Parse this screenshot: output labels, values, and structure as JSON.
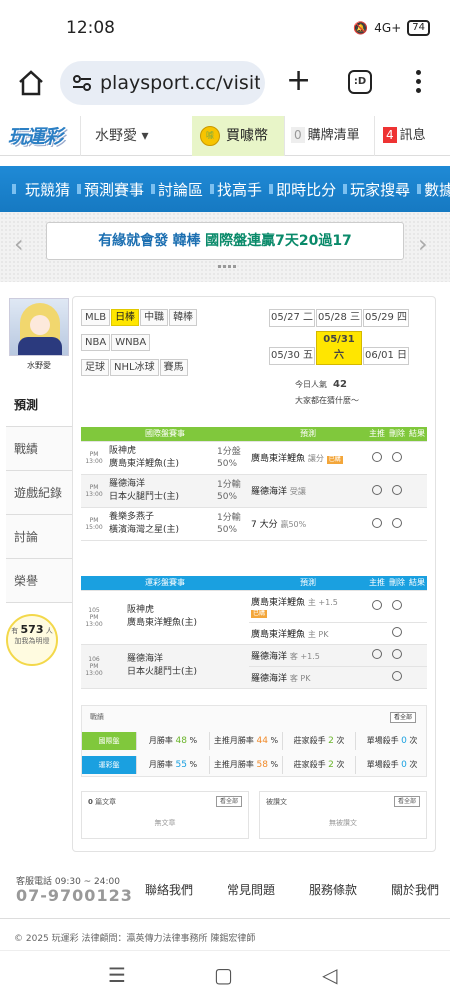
{
  "status": {
    "time": "12:08",
    "battery": "74",
    "signal": "4G+"
  },
  "browser": {
    "url": "playsport.cc/visit",
    "tab_count": ":D"
  },
  "topnav": {
    "logo": "玩運彩",
    "user": "水野愛 ▾",
    "buy": "買噱幣",
    "coin": "噱",
    "cart_count": "0",
    "cart": "購牌清單",
    "msg_count": "4",
    "msg": "訊息"
  },
  "mainnav": [
    "玩競猜",
    "預測賽事",
    "討論區",
    "找高手",
    "即時比分",
    "玩家搜尋",
    "數據"
  ],
  "ticker": {
    "part1": "有緣就會發",
    "part2": "韓棒",
    "part3": "國際盤連贏7天20過17"
  },
  "sidebar": {
    "username": "水野愛",
    "menu": [
      "預測",
      "戰績",
      "遊戲紀錄",
      "討論",
      "榮譽"
    ],
    "bulb_pre": "有",
    "bulb_num": "573",
    "bulb_post": "人",
    "bulb_sub": "加我為明燈"
  },
  "leagues": [
    "MLB",
    "日棒",
    "中職",
    "韓棒",
    "NBA",
    "WNBA",
    "足球",
    "NHL冰球",
    "賽馬"
  ],
  "dates": [
    "05/27 二",
    "05/28 三",
    "05/29 四",
    "05/30 五",
    "05/31 六",
    "06/01 日"
  ],
  "popularity": {
    "label": "今日人氣",
    "value": "42",
    "note": "大家都在猜什麼～"
  },
  "intl": {
    "header": [
      "國際盤賽事",
      "預測",
      "主推",
      "刪除",
      "結果"
    ],
    "rows": [
      {
        "time": "PM 13:00",
        "teams": "阪神虎\n廣島東洋鯉魚(主)",
        "pk": "1分盤\n50%",
        "pick": "廣島東洋鯉魚",
        "note": "讓分",
        "tag": "已購"
      },
      {
        "time": "PM 13:00",
        "teams": "羅德海洋\n日本火腿鬥士(主)",
        "pk": "1分輸\n50%",
        "pick": "羅德海洋",
        "note": "受讓",
        "tag": ""
      },
      {
        "time": "PM 15:00",
        "teams": "養樂多燕子\n橫濱海灣之星(主)",
        "pk": "1分輸\n50%",
        "pick": "7 大分",
        "note": "贏50%",
        "tag": ""
      }
    ]
  },
  "local": {
    "header": [
      "運彩盤賽事",
      "預測",
      "主推",
      "刪除",
      "結果"
    ],
    "rows": [
      {
        "no": "105",
        "time": "PM 13:00",
        "teams": "阪神虎\n廣島東洋鯉魚(主)",
        "picks": [
          {
            "pick": "廣島東洋鯉魚",
            "note": "主 +1.5",
            "tag": "已購"
          },
          {
            "pick": "廣島東洋鯉魚",
            "note": "主 PK",
            "tag": ""
          }
        ]
      },
      {
        "no": "106",
        "time": "PM 13:00",
        "teams": "羅德海洋\n日本火腿鬥士(主)",
        "picks": [
          {
            "pick": "羅德海洋",
            "note": "客 +1.5",
            "tag": ""
          },
          {
            "pick": "羅德海洋",
            "note": "客 PK",
            "tag": ""
          }
        ]
      }
    ]
  },
  "stats": {
    "title": "戰績",
    "button": "看全部",
    "rows": [
      {
        "label": "國際盤",
        "color": "#80c83c",
        "win_label": "月勝率",
        "win": "48",
        "pt_label": "主推月勝率",
        "pt": "44",
        "s1_label": "莊家殺手",
        "s1": "2",
        "s2_label": "單場殺手",
        "s2": "0",
        "unit": "次"
      },
      {
        "label": "運彩盤",
        "color": "#1aa0e0",
        "win_label": "月勝率",
        "win": "55",
        "pt_label": "主推月勝率",
        "pt": "58",
        "s1_label": "莊家殺手",
        "s1": "2",
        "s2_label": "單場殺手",
        "s2": "0",
        "unit": "次"
      }
    ]
  },
  "posts": {
    "left_count": "0",
    "left_title": "篇文章",
    "left_btn": "看全部",
    "left_empty": "無文章",
    "right_title": "被讚文",
    "right_btn": "看全部",
    "right_empty": "無被讚文"
  },
  "footer": {
    "tel_label": "客服電話 09:30 ~ 24:00",
    "tel": "07-9700123",
    "links": [
      "聯絡我們",
      "常見問題",
      "服務條款",
      "關於我們"
    ],
    "copyright": "© 2025 玩運彩 法律顧問：瀛英傳力法律事務所 陳錫宏律師"
  }
}
